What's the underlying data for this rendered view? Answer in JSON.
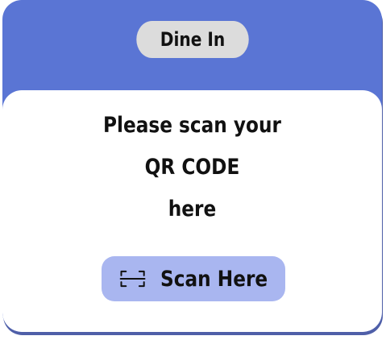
{
  "header": {
    "mode_label": "Dine In"
  },
  "panel": {
    "message_lines": [
      "Please scan your",
      "QR CODE",
      "here"
    ]
  },
  "scan_button": {
    "label": "Scan Here",
    "icon": "qr-scan-icon"
  },
  "colors": {
    "header_bg": "#5a75d4",
    "pill_bg": "#dcdcdc",
    "button_bg": "#a9b6f0"
  }
}
